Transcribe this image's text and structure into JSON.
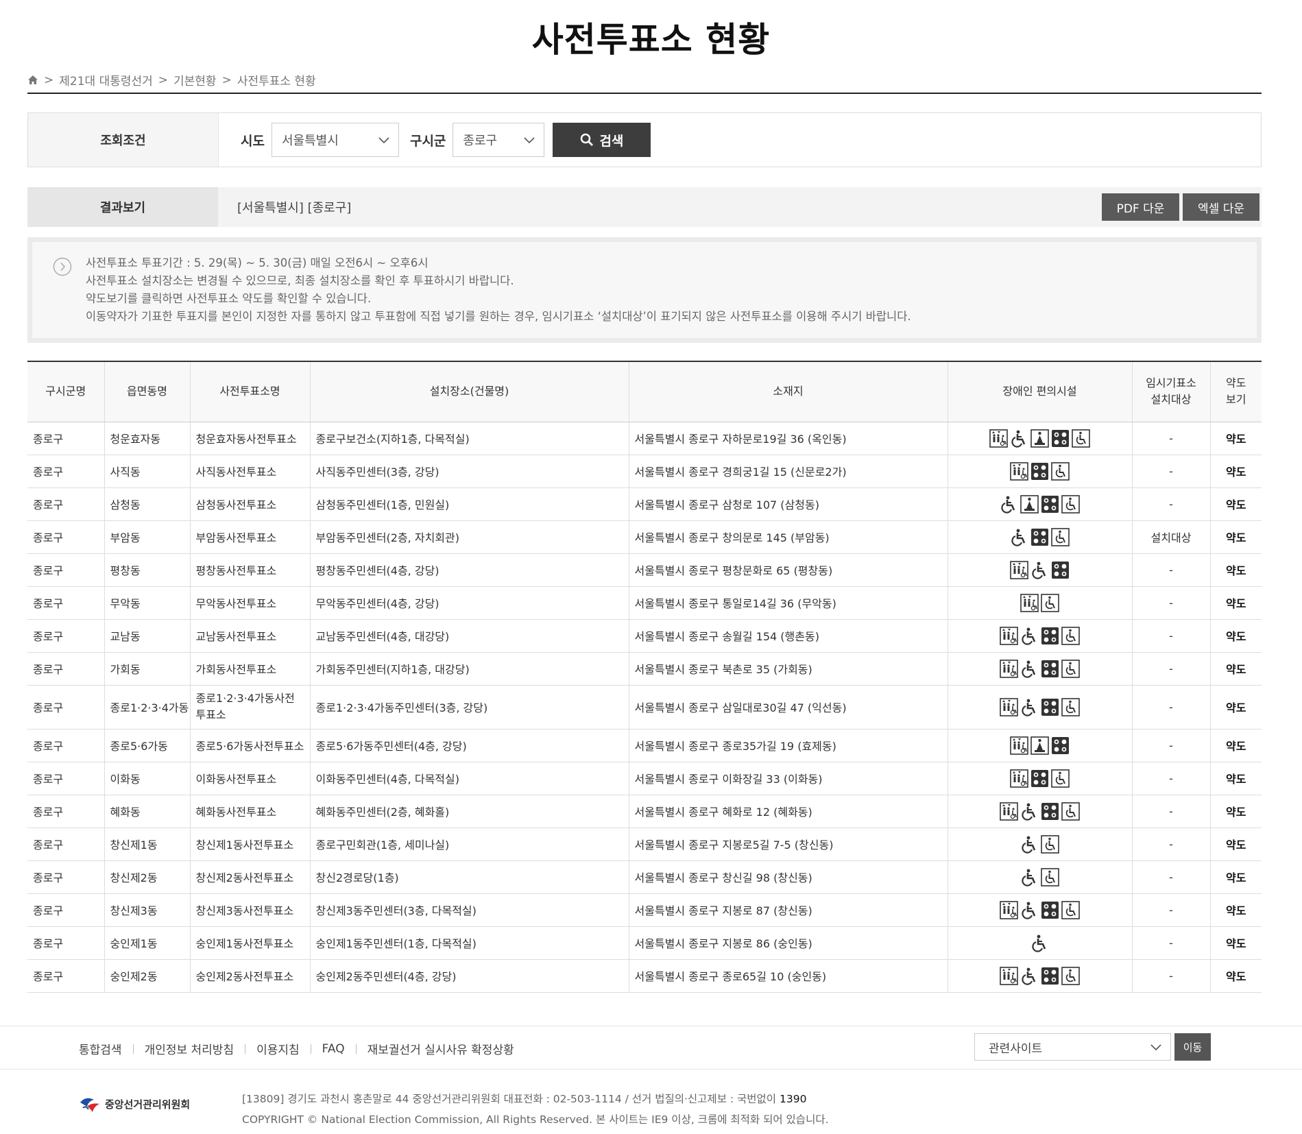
{
  "page": {
    "title": "사전투표소 현황"
  },
  "breadcrumb": {
    "items": [
      "제21대 대통령선거",
      "기본현황",
      "사전투표소 현황"
    ],
    "sep": ">"
  },
  "search": {
    "label": "조회조건",
    "sido_label": "시도",
    "sido_value": "서울특별시",
    "gu_label": "구시군",
    "gu_value": "종로구",
    "button": "검색"
  },
  "result": {
    "label": "결과보기",
    "text": "[서울특별시] [종로구]",
    "pdf_button": "PDF 다운",
    "excel_button": "엑셀 다운"
  },
  "notice": {
    "lines": [
      "사전투표소 투표기간 : 5. 29(목) ~ 5. 30(금) 매일 오전6시 ~ 오후6시",
      "사전투표소 설치장소는 변경될 수 있으므로, 최종 설치장소를 확인 후 투표하시기 바랍니다.",
      "약도보기를 클릭하면 사전투표소 약도를 확인할 수 있습니다.",
      "이동약자가 기표한 투표지를 본인이 지정한 자를 통하지 않고 투표함에 직접 넣기를 원하는 경우, 임시기표소 ‘설치대상’이 표기되지 않은 사전투표소를 이용해 주시기 바랍니다."
    ]
  },
  "table": {
    "headers": {
      "gu": "구시군명",
      "dong": "읍면동명",
      "name": "사전투표소명",
      "place": "설치장소(건물명)",
      "addr": "소재지",
      "facility": "장애인 편의시설",
      "temp1": "임시기표소",
      "temp2": "설치대상",
      "map1": "약도",
      "map2": "보기"
    },
    "rows": [
      {
        "gu": "종로구",
        "dong": "청운효자동",
        "name": "청운효자동사전투표소",
        "place": "종로구보건소(지하1층, 다목적실)",
        "addr": "서울특별시 종로구 자하문로19길 36 (옥인동)",
        "icons": [
          "elevator-icon",
          "wheelchair-icon",
          "ramp-icon",
          "braille-icon",
          "accessible-toilet-icon"
        ],
        "temp": "-",
        "map": "약도"
      },
      {
        "gu": "종로구",
        "dong": "사직동",
        "name": "사직동사전투표소",
        "place": "사직동주민센터(3층, 강당)",
        "addr": "서울특별시 종로구 경희궁1길 15 (신문로2가)",
        "icons": [
          "elevator-icon",
          "braille-icon",
          "accessible-toilet-icon"
        ],
        "temp": "-",
        "map": "약도"
      },
      {
        "gu": "종로구",
        "dong": "삼청동",
        "name": "삼청동사전투표소",
        "place": "삼청동주민센터(1층, 민원실)",
        "addr": "서울특별시 종로구 삼청로 107 (삼청동)",
        "icons": [
          "wheelchair-icon",
          "ramp-icon",
          "braille-icon",
          "accessible-toilet-icon"
        ],
        "temp": "-",
        "map": "약도"
      },
      {
        "gu": "종로구",
        "dong": "부암동",
        "name": "부암동사전투표소",
        "place": "부암동주민센터(2층, 자치회관)",
        "addr": "서울특별시 종로구 창의문로 145 (부암동)",
        "icons": [
          "wheelchair-icon",
          "braille-icon",
          "accessible-toilet-icon"
        ],
        "temp": "설치대상",
        "map": "약도"
      },
      {
        "gu": "종로구",
        "dong": "평창동",
        "name": "평창동사전투표소",
        "place": "평창동주민센터(4층, 강당)",
        "addr": "서울특별시 종로구 평창문화로 65 (평창동)",
        "icons": [
          "elevator-icon",
          "wheelchair-icon",
          "braille-icon"
        ],
        "temp": "-",
        "map": "약도"
      },
      {
        "gu": "종로구",
        "dong": "무악동",
        "name": "무악동사전투표소",
        "place": "무악동주민센터(4층, 강당)",
        "addr": "서울특별시 종로구 통일로14길 36 (무악동)",
        "icons": [
          "elevator-icon",
          "accessible-toilet-icon"
        ],
        "temp": "-",
        "map": "약도"
      },
      {
        "gu": "종로구",
        "dong": "교남동",
        "name": "교남동사전투표소",
        "place": "교남동주민센터(4층, 대강당)",
        "addr": "서울특별시 종로구 송월길 154 (행촌동)",
        "icons": [
          "elevator-icon",
          "wheelchair-icon",
          "braille-icon",
          "accessible-toilet-icon"
        ],
        "temp": "-",
        "map": "약도"
      },
      {
        "gu": "종로구",
        "dong": "가회동",
        "name": "가회동사전투표소",
        "place": "가회동주민센터(지하1층, 대강당)",
        "addr": "서울특별시 종로구 북촌로 35 (가회동)",
        "icons": [
          "elevator-icon",
          "wheelchair-icon",
          "braille-icon",
          "accessible-toilet-icon"
        ],
        "temp": "-",
        "map": "약도"
      },
      {
        "gu": "종로구",
        "dong": "종로1·2·3·4가동",
        "name": "종로1·2·3·4가동사전투표소",
        "place": "종로1·2·3·4가동주민센터(3층, 강당)",
        "addr": "서울특별시 종로구 삼일대로30길 47 (익선동)",
        "icons": [
          "elevator-icon",
          "wheelchair-icon",
          "braille-icon",
          "accessible-toilet-icon"
        ],
        "temp": "-",
        "map": "약도",
        "tall": true
      },
      {
        "gu": "종로구",
        "dong": "종로5·6가동",
        "name": "종로5·6가동사전투표소",
        "place": "종로5·6가동주민센터(4층, 강당)",
        "addr": "서울특별시 종로구 종로35가길 19 (효제동)",
        "icons": [
          "elevator-icon",
          "ramp-icon",
          "braille-icon"
        ],
        "temp": "-",
        "map": "약도"
      },
      {
        "gu": "종로구",
        "dong": "이화동",
        "name": "이화동사전투표소",
        "place": "이화동주민센터(4층, 다목적실)",
        "addr": "서울특별시 종로구 이화장길 33 (이화동)",
        "icons": [
          "elevator-icon",
          "braille-icon",
          "accessible-toilet-icon"
        ],
        "temp": "-",
        "map": "약도"
      },
      {
        "gu": "종로구",
        "dong": "혜화동",
        "name": "혜화동사전투표소",
        "place": "혜화동주민센터(2층, 혜화홀)",
        "addr": "서울특별시 종로구 혜화로 12 (혜화동)",
        "icons": [
          "elevator-icon",
          "wheelchair-icon",
          "braille-icon",
          "accessible-toilet-icon"
        ],
        "temp": "-",
        "map": "약도"
      },
      {
        "gu": "종로구",
        "dong": "창신제1동",
        "name": "창신제1동사전투표소",
        "place": "종로구민회관(1층, 세미나실)",
        "addr": "서울특별시 종로구 지봉로5길 7-5 (창신동)",
        "icons": [
          "wheelchair-icon",
          "accessible-toilet-icon"
        ],
        "temp": "-",
        "map": "약도"
      },
      {
        "gu": "종로구",
        "dong": "창신제2동",
        "name": "창신제2동사전투표소",
        "place": "창신2경로당(1층)",
        "addr": "서울특별시 종로구 창신길 98 (창신동)",
        "icons": [
          "wheelchair-icon",
          "accessible-toilet-icon"
        ],
        "temp": "-",
        "map": "약도"
      },
      {
        "gu": "종로구",
        "dong": "창신제3동",
        "name": "창신제3동사전투표소",
        "place": "창신제3동주민센터(3층, 다목적실)",
        "addr": "서울특별시 종로구 지봉로 87 (창신동)",
        "icons": [
          "elevator-icon",
          "wheelchair-icon",
          "braille-icon",
          "accessible-toilet-icon"
        ],
        "temp": "-",
        "map": "약도"
      },
      {
        "gu": "종로구",
        "dong": "숭인제1동",
        "name": "숭인제1동사전투표소",
        "place": "숭인제1동주민센터(1층, 다목적실)",
        "addr": "서울특별시 종로구 지봉로 86 (숭인동)",
        "icons": [
          "wheelchair-icon"
        ],
        "temp": "-",
        "map": "약도"
      },
      {
        "gu": "종로구",
        "dong": "숭인제2동",
        "name": "숭인제2동사전투표소",
        "place": "숭인제2동주민센터(4층, 강당)",
        "addr": "서울특별시 종로구 종로65길 10 (숭인동)",
        "icons": [
          "elevator-icon",
          "wheelchair-icon",
          "braille-icon",
          "accessible-toilet-icon"
        ],
        "temp": "-",
        "map": "약도"
      }
    ]
  },
  "footer": {
    "links": [
      "통합검색",
      "개인정보 처리방침",
      "이용지침",
      "FAQ",
      "재보궐선거 실시사유 확정상황"
    ],
    "related_label": "관련사이트",
    "move_button": "이동",
    "logo_text": "중앙선거관리위원회",
    "address_line": "[13809] 경기도 과천시 홍촌말로 44 중앙선거관리위원회 대표전화 : 02-503-1114 / 선거 법질의·신고제보 : 국번없이",
    "hotline": "1390",
    "copyright": "COPYRIGHT © National Election Commission, All Rights Reserved. 본 사이트는 IE9 이상, 크롬에 최적화 되어 있습니다."
  }
}
